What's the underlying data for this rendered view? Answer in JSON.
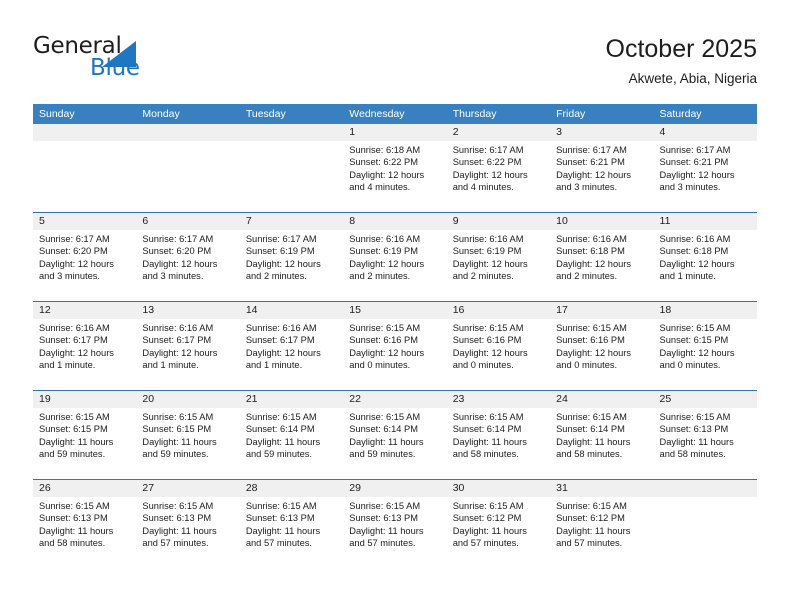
{
  "brand": {
    "name_part1": "General",
    "name_part2": "Blue",
    "accent_color": "#1f76c2",
    "logo_icon": "triangle-icon"
  },
  "header": {
    "title": "October 2025",
    "subtitle": "Akwete, Abia, Nigeria",
    "header_bg_color": "#3880c0",
    "row_divider_color": "#2f76b8",
    "date_strip_color": "#f0f0f0"
  },
  "weekdays": [
    "Sunday",
    "Monday",
    "Tuesday",
    "Wednesday",
    "Thursday",
    "Friday",
    "Saturday"
  ],
  "weeks": [
    [
      {
        "day": "",
        "sunrise": "",
        "sunset": "",
        "daylight_line1": "",
        "daylight_line2": ""
      },
      {
        "day": "",
        "sunrise": "",
        "sunset": "",
        "daylight_line1": "",
        "daylight_line2": ""
      },
      {
        "day": "",
        "sunrise": "",
        "sunset": "",
        "daylight_line1": "",
        "daylight_line2": ""
      },
      {
        "day": "1",
        "sunrise": "Sunrise: 6:18 AM",
        "sunset": "Sunset: 6:22 PM",
        "daylight_line1": "Daylight: 12 hours",
        "daylight_line2": "and 4 minutes."
      },
      {
        "day": "2",
        "sunrise": "Sunrise: 6:17 AM",
        "sunset": "Sunset: 6:22 PM",
        "daylight_line1": "Daylight: 12 hours",
        "daylight_line2": "and 4 minutes."
      },
      {
        "day": "3",
        "sunrise": "Sunrise: 6:17 AM",
        "sunset": "Sunset: 6:21 PM",
        "daylight_line1": "Daylight: 12 hours",
        "daylight_line2": "and 3 minutes."
      },
      {
        "day": "4",
        "sunrise": "Sunrise: 6:17 AM",
        "sunset": "Sunset: 6:21 PM",
        "daylight_line1": "Daylight: 12 hours",
        "daylight_line2": "and 3 minutes."
      }
    ],
    [
      {
        "day": "5",
        "sunrise": "Sunrise: 6:17 AM",
        "sunset": "Sunset: 6:20 PM",
        "daylight_line1": "Daylight: 12 hours",
        "daylight_line2": "and 3 minutes."
      },
      {
        "day": "6",
        "sunrise": "Sunrise: 6:17 AM",
        "sunset": "Sunset: 6:20 PM",
        "daylight_line1": "Daylight: 12 hours",
        "daylight_line2": "and 3 minutes."
      },
      {
        "day": "7",
        "sunrise": "Sunrise: 6:17 AM",
        "sunset": "Sunset: 6:19 PM",
        "daylight_line1": "Daylight: 12 hours",
        "daylight_line2": "and 2 minutes."
      },
      {
        "day": "8",
        "sunrise": "Sunrise: 6:16 AM",
        "sunset": "Sunset: 6:19 PM",
        "daylight_line1": "Daylight: 12 hours",
        "daylight_line2": "and 2 minutes."
      },
      {
        "day": "9",
        "sunrise": "Sunrise: 6:16 AM",
        "sunset": "Sunset: 6:19 PM",
        "daylight_line1": "Daylight: 12 hours",
        "daylight_line2": "and 2 minutes."
      },
      {
        "day": "10",
        "sunrise": "Sunrise: 6:16 AM",
        "sunset": "Sunset: 6:18 PM",
        "daylight_line1": "Daylight: 12 hours",
        "daylight_line2": "and 2 minutes."
      },
      {
        "day": "11",
        "sunrise": "Sunrise: 6:16 AM",
        "sunset": "Sunset: 6:18 PM",
        "daylight_line1": "Daylight: 12 hours",
        "daylight_line2": "and 1 minute."
      }
    ],
    [
      {
        "day": "12",
        "sunrise": "Sunrise: 6:16 AM",
        "sunset": "Sunset: 6:17 PM",
        "daylight_line1": "Daylight: 12 hours",
        "daylight_line2": "and 1 minute."
      },
      {
        "day": "13",
        "sunrise": "Sunrise: 6:16 AM",
        "sunset": "Sunset: 6:17 PM",
        "daylight_line1": "Daylight: 12 hours",
        "daylight_line2": "and 1 minute."
      },
      {
        "day": "14",
        "sunrise": "Sunrise: 6:16 AM",
        "sunset": "Sunset: 6:17 PM",
        "daylight_line1": "Daylight: 12 hours",
        "daylight_line2": "and 1 minute."
      },
      {
        "day": "15",
        "sunrise": "Sunrise: 6:15 AM",
        "sunset": "Sunset: 6:16 PM",
        "daylight_line1": "Daylight: 12 hours",
        "daylight_line2": "and 0 minutes."
      },
      {
        "day": "16",
        "sunrise": "Sunrise: 6:15 AM",
        "sunset": "Sunset: 6:16 PM",
        "daylight_line1": "Daylight: 12 hours",
        "daylight_line2": "and 0 minutes."
      },
      {
        "day": "17",
        "sunrise": "Sunrise: 6:15 AM",
        "sunset": "Sunset: 6:16 PM",
        "daylight_line1": "Daylight: 12 hours",
        "daylight_line2": "and 0 minutes."
      },
      {
        "day": "18",
        "sunrise": "Sunrise: 6:15 AM",
        "sunset": "Sunset: 6:15 PM",
        "daylight_line1": "Daylight: 12 hours",
        "daylight_line2": "and 0 minutes."
      }
    ],
    [
      {
        "day": "19",
        "sunrise": "Sunrise: 6:15 AM",
        "sunset": "Sunset: 6:15 PM",
        "daylight_line1": "Daylight: 11 hours",
        "daylight_line2": "and 59 minutes."
      },
      {
        "day": "20",
        "sunrise": "Sunrise: 6:15 AM",
        "sunset": "Sunset: 6:15 PM",
        "daylight_line1": "Daylight: 11 hours",
        "daylight_line2": "and 59 minutes."
      },
      {
        "day": "21",
        "sunrise": "Sunrise: 6:15 AM",
        "sunset": "Sunset: 6:14 PM",
        "daylight_line1": "Daylight: 11 hours",
        "daylight_line2": "and 59 minutes."
      },
      {
        "day": "22",
        "sunrise": "Sunrise: 6:15 AM",
        "sunset": "Sunset: 6:14 PM",
        "daylight_line1": "Daylight: 11 hours",
        "daylight_line2": "and 59 minutes."
      },
      {
        "day": "23",
        "sunrise": "Sunrise: 6:15 AM",
        "sunset": "Sunset: 6:14 PM",
        "daylight_line1": "Daylight: 11 hours",
        "daylight_line2": "and 58 minutes."
      },
      {
        "day": "24",
        "sunrise": "Sunrise: 6:15 AM",
        "sunset": "Sunset: 6:14 PM",
        "daylight_line1": "Daylight: 11 hours",
        "daylight_line2": "and 58 minutes."
      },
      {
        "day": "25",
        "sunrise": "Sunrise: 6:15 AM",
        "sunset": "Sunset: 6:13 PM",
        "daylight_line1": "Daylight: 11 hours",
        "daylight_line2": "and 58 minutes."
      }
    ],
    [
      {
        "day": "26",
        "sunrise": "Sunrise: 6:15 AM",
        "sunset": "Sunset: 6:13 PM",
        "daylight_line1": "Daylight: 11 hours",
        "daylight_line2": "and 58 minutes."
      },
      {
        "day": "27",
        "sunrise": "Sunrise: 6:15 AM",
        "sunset": "Sunset: 6:13 PM",
        "daylight_line1": "Daylight: 11 hours",
        "daylight_line2": "and 57 minutes."
      },
      {
        "day": "28",
        "sunrise": "Sunrise: 6:15 AM",
        "sunset": "Sunset: 6:13 PM",
        "daylight_line1": "Daylight: 11 hours",
        "daylight_line2": "and 57 minutes."
      },
      {
        "day": "29",
        "sunrise": "Sunrise: 6:15 AM",
        "sunset": "Sunset: 6:13 PM",
        "daylight_line1": "Daylight: 11 hours",
        "daylight_line2": "and 57 minutes."
      },
      {
        "day": "30",
        "sunrise": "Sunrise: 6:15 AM",
        "sunset": "Sunset: 6:12 PM",
        "daylight_line1": "Daylight: 11 hours",
        "daylight_line2": "and 57 minutes."
      },
      {
        "day": "31",
        "sunrise": "Sunrise: 6:15 AM",
        "sunset": "Sunset: 6:12 PM",
        "daylight_line1": "Daylight: 11 hours",
        "daylight_line2": "and 57 minutes."
      },
      {
        "day": "",
        "sunrise": "",
        "sunset": "",
        "daylight_line1": "",
        "daylight_line2": ""
      }
    ]
  ]
}
